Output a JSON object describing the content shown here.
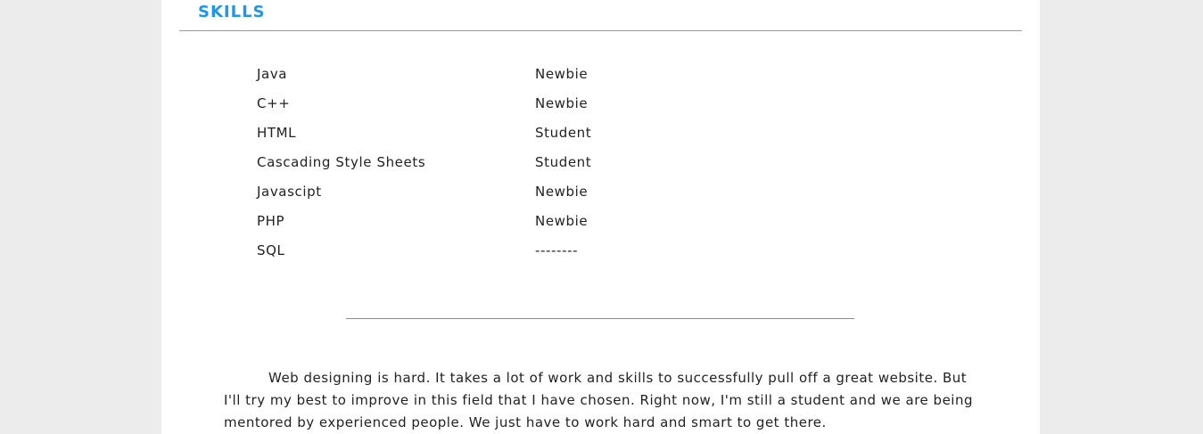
{
  "colors": {
    "background": "#ececec",
    "page": "#ffffff",
    "accent": "#2196e8",
    "text": "#222222",
    "rule": "#9a9a9a"
  },
  "skills_section": {
    "title": "SKILLS",
    "rows": [
      {
        "skill": "Java",
        "level": "Newbie"
      },
      {
        "skill": "C++",
        "level": "Newbie"
      },
      {
        "skill": "HTML",
        "level": "Student"
      },
      {
        "skill": "Cascading Style Sheets",
        "level": "Student"
      },
      {
        "skill": "Javascipt",
        "level": "Newbie"
      },
      {
        "skill": "PHP",
        "level": "Newbie"
      },
      {
        "skill": "SQL",
        "level": "--------"
      }
    ]
  },
  "about": {
    "paragraph": "Web designing is hard. It takes a lot of work and skills to successfully pull off a great website. But I'll try my best to improve in this field that I have chosen. Right now, I'm still a student and we are being mentored by experienced people. We just have to work hard and smart to get there."
  }
}
